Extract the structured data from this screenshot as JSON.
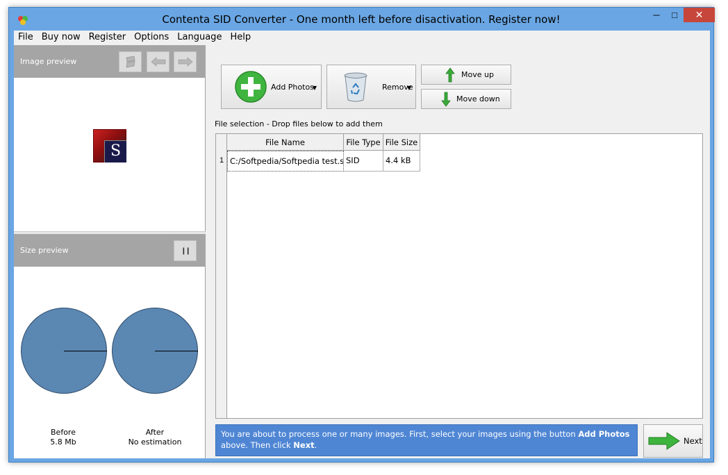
{
  "window": {
    "title": "Contenta SID Converter  - One month left before disactivation. Register now!",
    "min_glyph": "─",
    "max_glyph": "□",
    "close_glyph": "✕"
  },
  "menu": [
    "File",
    "Buy now",
    "Register",
    "Options",
    "Language",
    "Help"
  ],
  "left_panel": {
    "image_preview_title": "Image preview",
    "thumb_letter": "S",
    "size_preview_title": "Size preview",
    "pause_glyph": "❙❙",
    "before_label": "Before",
    "before_value": "5.8 Mb",
    "after_label": "After",
    "after_value": "No estimation"
  },
  "toolbar": {
    "add_label": "Add Photos",
    "remove_label": "Remove",
    "move_up_label": "Move up",
    "move_down_label": "Move down",
    "caret": "▼"
  },
  "file_selection_label": "File selection - Drop files below to add them",
  "table": {
    "columns": [
      "File Name",
      "File Type",
      "File Size"
    ],
    "rows": [
      {
        "index": "1",
        "name": "C:/Softpedia/Softpedia test.sid",
        "type": "SID",
        "size": "4.4 kB"
      }
    ]
  },
  "info": {
    "text_1": "You are about to process one or many images. First, select your images using the button ",
    "bold_1": "Add Photos",
    "text_2": " above. Then click ",
    "bold_2": "Next",
    "text_3": "."
  },
  "next_label": "Next",
  "colors": {
    "accent": "#4f86d4",
    "pie": "#5b87b3",
    "close": "#c7463b"
  }
}
